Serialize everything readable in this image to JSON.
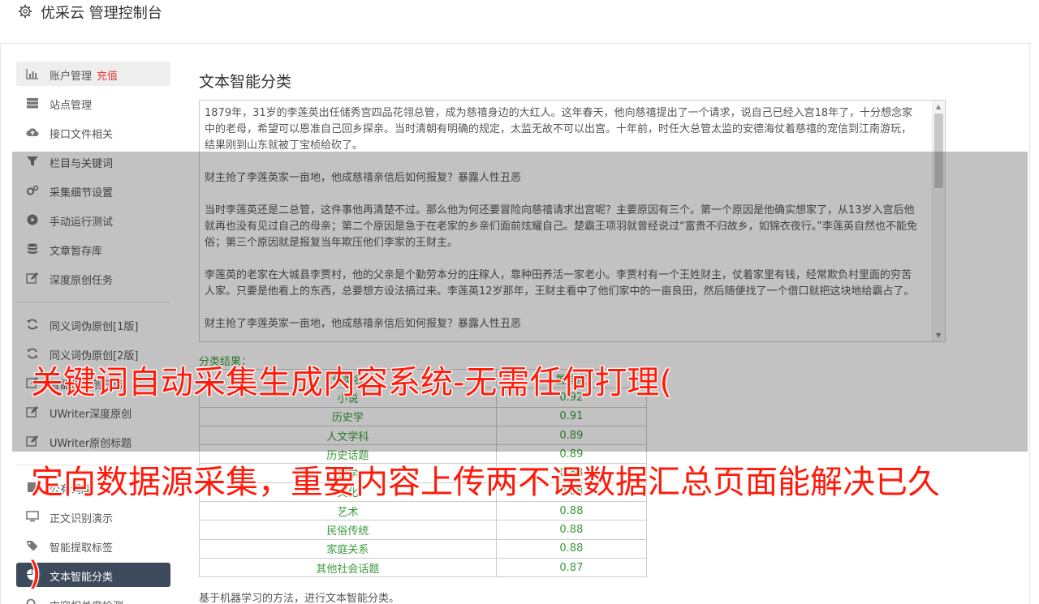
{
  "app": {
    "title": "优采云 管理控制台"
  },
  "sidebar": {
    "items": [
      {
        "label": "账户管理",
        "extra": "充值",
        "icon": "bar-chart-icon"
      },
      {
        "label": "站点管理",
        "icon": "server-icon"
      },
      {
        "label": "接口文件相关",
        "icon": "cloud-upload-icon"
      },
      {
        "label": "栏目与关键词",
        "icon": "filter-icon"
      },
      {
        "label": "采集细节设置",
        "icon": "gears-icon"
      },
      {
        "label": "手动运行测试",
        "icon": "play-icon"
      },
      {
        "label": "文章暂存库",
        "icon": "database-icon"
      },
      {
        "label": "深度原创任务",
        "icon": "edit-icon"
      },
      {
        "label": "同义词伪原创[1版]",
        "icon": "refresh-icon"
      },
      {
        "label": "同义词伪原创[2版]",
        "icon": "refresh-icon"
      },
      {
        "label": "智能伪原创任务",
        "icon": "edit-icon"
      },
      {
        "label": "UWriter深度原创",
        "icon": "edit-icon"
      },
      {
        "label": "UWriter原创标题",
        "icon": "edit-icon"
      },
      {
        "label": "公有词库",
        "icon": "book-icon"
      },
      {
        "label": "正文识别演示",
        "icon": "desktop-icon"
      },
      {
        "label": "智能提取标签",
        "icon": "tag-icon"
      },
      {
        "label": "文本智能分类",
        "icon": "pie-chart-icon"
      },
      {
        "label": "内容相关度检测",
        "icon": "search-icon"
      }
    ]
  },
  "main": {
    "heading": "文本智能分类",
    "article": [
      "1879年，31岁的李莲英出任储秀宫四品花翎总管，成为慈禧身边的大红人。这年春天，他向慈禧提出了一个请求，说自己已经入宫18年了，十分想念家中的老母，希望可以恩准自己回乡探亲。当时清朝有明确的规定，太监无故不可以出宫。十年前，时任大总管太监的安德海仗着慈禧的宠信到江南游玩，结果刚到山东就被丁宝桢给砍了。",
      "财主抢了李莲英家一亩地，他成慈禧亲信后如何报复？暴露人性丑恶",
      "当时李莲英还是二总管，这件事他再清楚不过。那么他为何还要冒险向慈禧请求出宫呢？主要原因有三个。第一个原因是他确实想家了，从13岁入宫后他就再也没有见过自己的母亲；第二个原因是急于在老家的乡亲们面前炫耀自己。楚霸王项羽就曾经说过“富贵不归故乡，如锦衣夜行。”李莲英自然也不能免俗；第三个原因就是报复当年欺压他们李家的王财主。",
      "李莲英的老家在大城县李贾村，他的父亲是个勤劳本分的庄稼人，靠种田养活一家老小。李贾村有一个王姓财主，仗着家里有钱，经常欺负村里面的穷苦人家。只要是他看上的东西，总要想方设法搞过来。李莲英12岁那年，王财主看中了他们家中的一亩良田，然后随便找了一个借口就把这块地给霸占了。",
      "财主抢了李莲英家一亩地，他成慈禧亲信后如何报复？暴露人性丑恶"
    ],
    "result_label": "分类结果：",
    "table": {
      "headers": [
        "分类名",
        "置信度"
      ],
      "rows": [
        [
          "小说",
          "0.92"
        ],
        [
          "历史学",
          "0.91"
        ],
        [
          "人文学科",
          "0.89"
        ],
        [
          "历史话题",
          "0.89"
        ],
        [
          "文学",
          "0.88"
        ],
        [
          "文化",
          "0.88"
        ],
        [
          "艺术",
          "0.88"
        ],
        [
          "民俗传统",
          "0.88"
        ],
        [
          "家庭关系",
          "0.88"
        ],
        [
          "其他社会话题",
          "0.87"
        ]
      ]
    },
    "footnote": "基于机器学习的方法，进行文本智能分类。"
  },
  "banner": {
    "line1": "关键词自动采集生成内容系统-无需任何打理(",
    "line2": "定向数据源采集，重要内容上传两不误数据汇总页面能解决已久",
    "line3": ")"
  },
  "colors": {
    "accent_red": "#ff1a0a",
    "active_bg": "#3c4a5c",
    "result_green": "#3a9a3a"
  }
}
